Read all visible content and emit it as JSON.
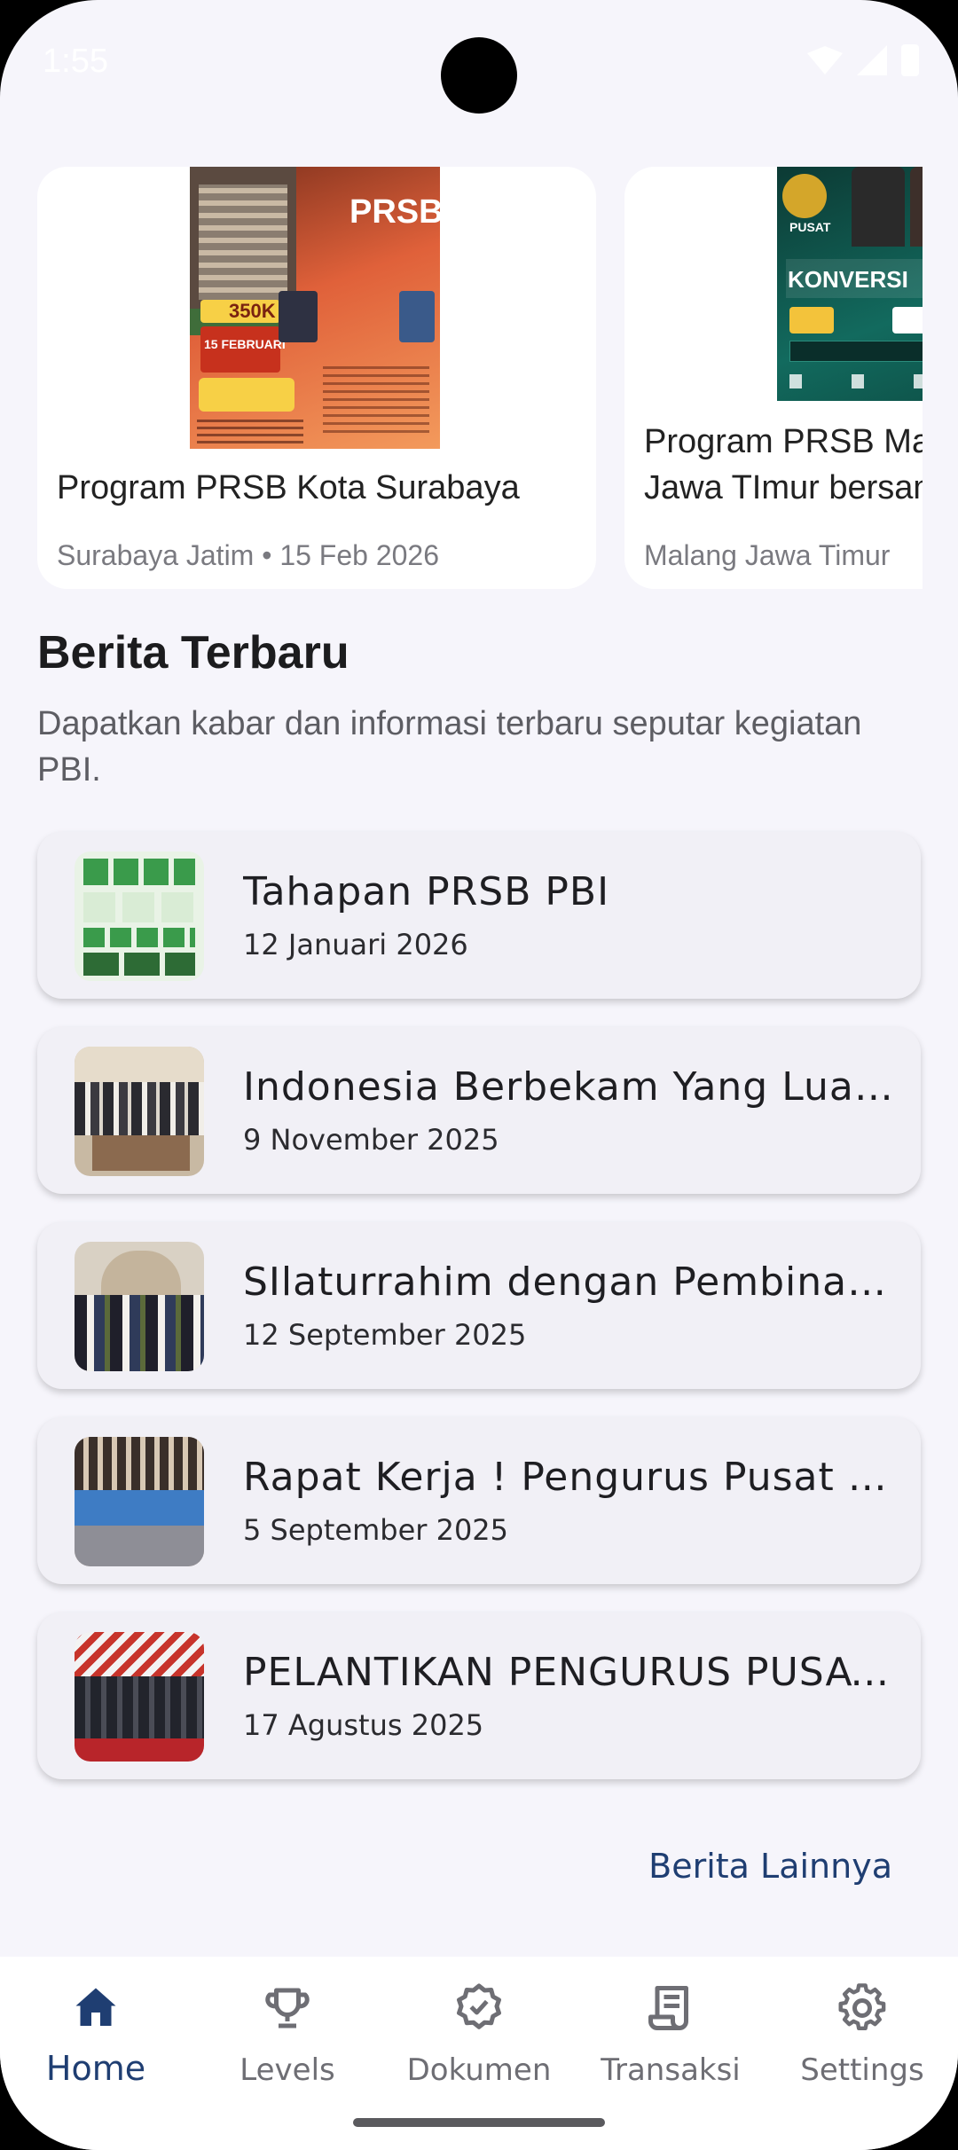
{
  "status": {
    "time": "1:55"
  },
  "events": [
    {
      "title": "Program PRSB Kota Surabaya",
      "meta": "Surabaya Jatim • 15 Feb 2026",
      "poster": {
        "heading": "PRSB",
        "price": "350K",
        "date_label": "15 FEBRUARI"
      }
    },
    {
      "title": "Program PRSB  Malang Jawa TImur bersama T",
      "meta": "Malang Jawa Timur",
      "poster": {
        "heading": "KONVERSI",
        "badge": "PUSAT"
      }
    }
  ],
  "news_section": {
    "title": "Berita Terbaru",
    "description": "Dapatkan kabar dan informasi terbaru seputar kegiatan PBI.",
    "items": [
      {
        "title": "Tahapan PRSB PBI",
        "date": "12 Januari 2026"
      },
      {
        "title": "Indonesia Berbekam Yang Luar Biasa",
        "date": "9 November 2025"
      },
      {
        "title": "SIlaturrahim dengan Pembina PBI",
        "date": "12 September 2025"
      },
      {
        "title": "Rapat Kerja ! Pengurus Pusat PBI",
        "date": "5 September 2025"
      },
      {
        "title": "PELANTIKAN PENGURUS PUSAT PBI",
        "date": "17 Agustus 2025"
      }
    ],
    "more_label": "Berita Lainnya"
  },
  "nav": {
    "home": "Home",
    "levels": "Levels",
    "documents": "Dokumen",
    "transactions": "Transaksi",
    "settings": "Settings"
  },
  "colors": {
    "accent": "#1f3e72",
    "background": "#f6f5fb"
  }
}
